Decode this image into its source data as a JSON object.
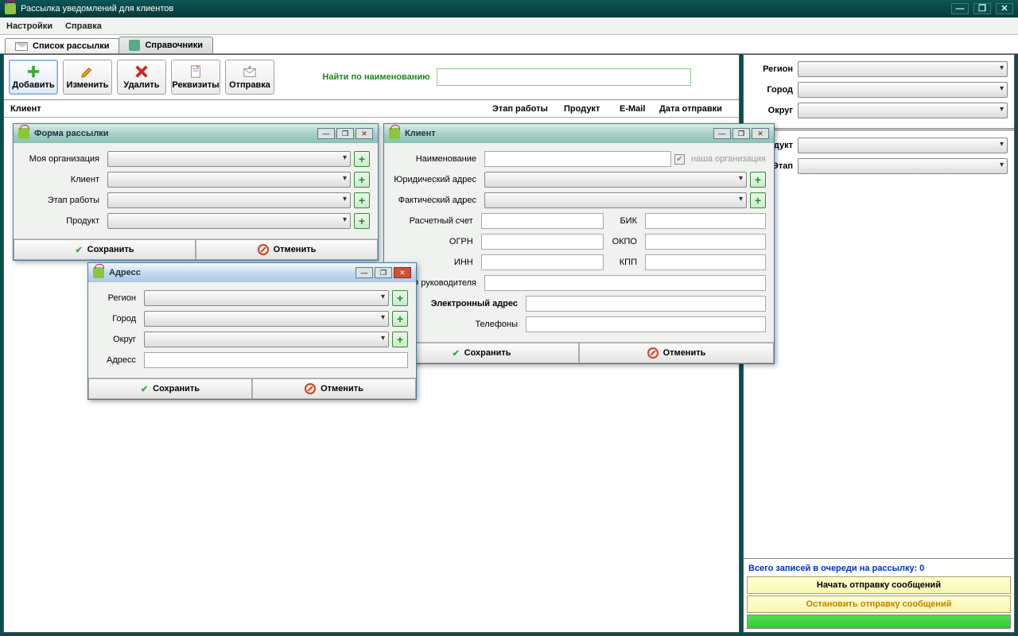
{
  "app_title": "Рассылка уведомлений для клиентов",
  "menu": {
    "settings": "Настройки",
    "help": "Справка"
  },
  "tabs": {
    "list": "Список рассылки",
    "refs": "Справочники"
  },
  "toolbar": {
    "add": "Добавить",
    "edit": "Изменить",
    "delete": "Удалить",
    "requisites": "Реквизиты",
    "send": "Отправка"
  },
  "search": {
    "label": "Найти по наименованию",
    "value": ""
  },
  "grid_headers": {
    "client": "Клиент",
    "stage": "Этап работы",
    "product": "Продукт",
    "email": "E-Mail",
    "date": "Дата отправки"
  },
  "right": {
    "region": "Регион",
    "city": "Город",
    "district": "Округ",
    "product": "Продукт",
    "stage": "Этап",
    "queue_label": "Всего записей в очереди на рассылку: ",
    "queue_count": "0",
    "start_btn": "Начать отправку сообщений",
    "stop_btn": "Остановить отправку сообщений"
  },
  "modal_form": {
    "title": "Форма рассылки",
    "my_org": "Моя организация",
    "client": "Клиент",
    "stage": "Этап работы",
    "product": "Продукт",
    "save": "Сохранить",
    "cancel": "Отменить"
  },
  "modal_client": {
    "title": "Клиент",
    "name": "Наименование",
    "our_org": "наша организация",
    "legal_addr": "Юридический адрес",
    "actual_addr": "Фактический адрес",
    "account": "Расчетный счет",
    "bik": "БИК",
    "ogrn": "ОГРН",
    "okpo": "ОКПО",
    "inn": "ИНН",
    "kpp": "КПП",
    "director": "ФИО руководителя",
    "email": "Электронный адрес",
    "phones": "Телефоны",
    "save": "Сохранить",
    "cancel": "Отменить"
  },
  "modal_address": {
    "title": "Адресс",
    "region": "Регион",
    "city": "Город",
    "district": "Округ",
    "address": "Адресс",
    "save": "Сохранить",
    "cancel": "Отменить"
  }
}
